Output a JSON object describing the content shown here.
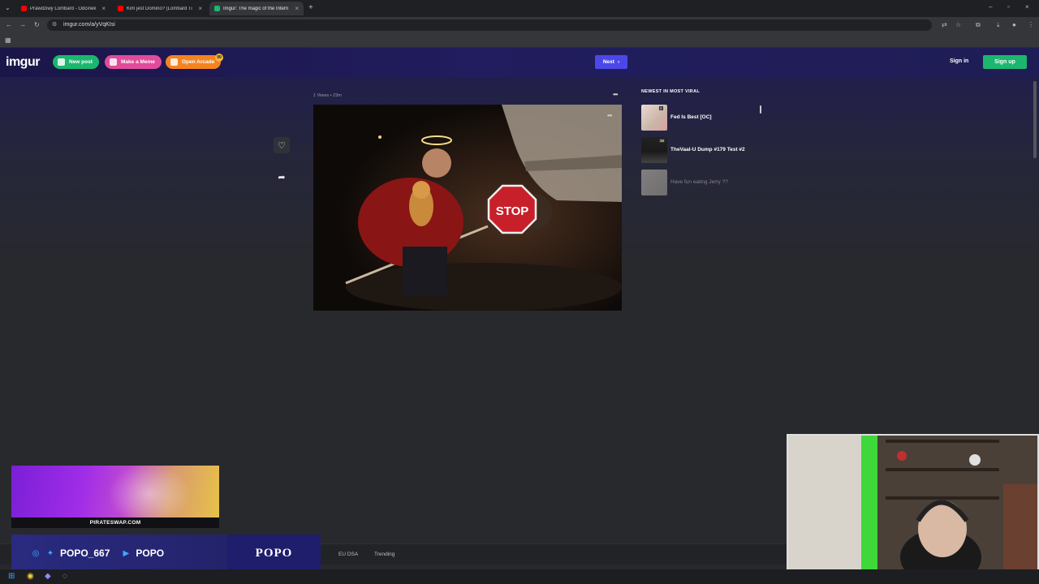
{
  "browser": {
    "tabs": [
      {
        "label": "Prawdziwy Lombard - Odcinek",
        "color": "#ff0000"
      },
      {
        "label": "Kim jest Domino? (Lombard Ti",
        "color": "#ff0000"
      },
      {
        "label": "Imgur: The magic of the Intern",
        "color": "#1bb76e"
      }
    ],
    "url": "imgur.com/a/yVqKIsi"
  },
  "header": {
    "logo": "imgur",
    "new_post": "New post",
    "make_meme": "Make a Meme",
    "open_arcade": "Open Arcade",
    "arcade_badge": "99",
    "next": "Next",
    "sign_in": "Sign in",
    "sign_up": "Sign up"
  },
  "post": {
    "meta": "1 Views • 23m",
    "image_icon": "stop-sign-photo-icon"
  },
  "sidebar": {
    "title": "NEWEST IN MOST VIRAL",
    "posts": [
      {
        "title": "Fed Is Best [OC]",
        "count": "2"
      },
      {
        "title": "TheVaal-U Dump #179  Test #2",
        "count": "38"
      },
      {
        "title": "Have fun eating Jerry ??",
        "count": ""
      }
    ]
  },
  "footer": {
    "links": [
      "EU DSA",
      "Trending"
    ]
  },
  "overlay": {
    "promo_caption": "PIRATESWAP.COM",
    "social_handle": "POPO_667",
    "youtube_handle": "POPO",
    "brand": "POPO"
  },
  "colors": {
    "accent_green": "#1bb76e",
    "accent_blue": "#4c48e8",
    "meme_pink": "#e14c9a",
    "arcade_orange": "#f5831f"
  }
}
